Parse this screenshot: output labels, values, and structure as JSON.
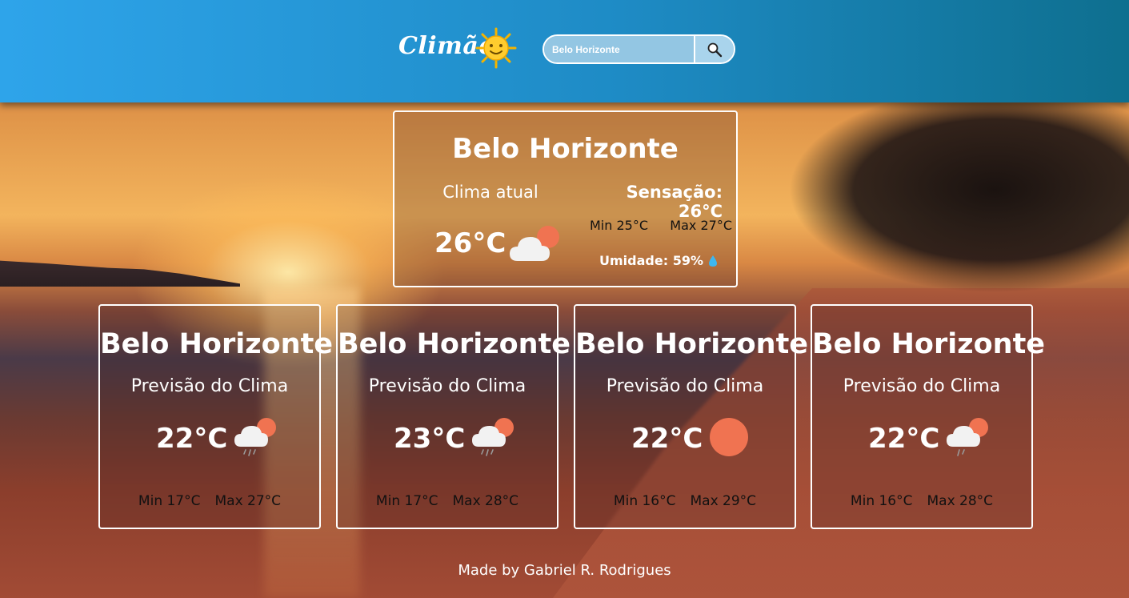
{
  "header": {
    "logo_text": "Climão",
    "search": {
      "value": "Belo Horizonte",
      "placeholder": "Belo Horizonte"
    },
    "search_icon": "magnifier-icon",
    "colors": {
      "header_start": "#2ea4ea",
      "header_end": "#0e6f8f"
    }
  },
  "current": {
    "city": "Belo Horizonte",
    "subtitle": "Clima atual",
    "temp": "26°C",
    "icon": "cloud-sun-icon",
    "feels": "Sensação: 26°C",
    "min": "Min 25°C",
    "max": "Max 27°C",
    "humidity": "Umidade: 59%",
    "humidity_icon": "droplet-icon"
  },
  "forecast": [
    {
      "city": "Belo Horizonte",
      "subtitle": "Previsão do Clima",
      "temp": "22°C",
      "icon": "cloud-sun-rain-icon",
      "min": "Min 17°C",
      "max": "Max 27°C"
    },
    {
      "city": "Belo Horizonte",
      "subtitle": "Previsão do Clima",
      "temp": "23°C",
      "icon": "cloud-sun-rain-icon",
      "min": "Min 17°C",
      "max": "Max 28°C"
    },
    {
      "city": "Belo Horizonte",
      "subtitle": "Previsão do Clima",
      "temp": "22°C",
      "icon": "sun-icon",
      "min": "Min 16°C",
      "max": "Max 29°C"
    },
    {
      "city": "Belo Horizonte",
      "subtitle": "Previsão do Clima",
      "temp": "22°C",
      "icon": "cloud-sun-rain-icon",
      "min": "Min 16°C",
      "max": "Max 28°C"
    }
  ],
  "footer": {
    "credit": "Made by Gabriel R. Rodrigues"
  },
  "colors": {
    "sun_accent": "#f07351",
    "cloud": "#f2f2f2",
    "droplet": "#3db7f0"
  }
}
